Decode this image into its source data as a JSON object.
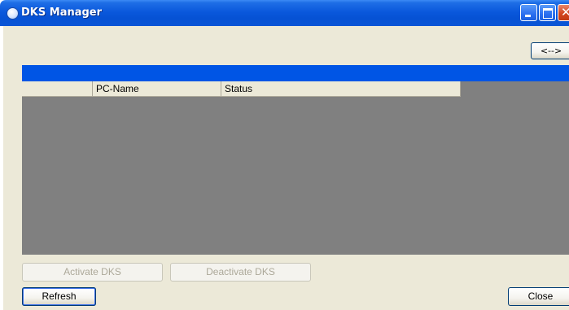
{
  "window": {
    "title": "DKS Manager",
    "close_glyph": "✕"
  },
  "toolbar": {
    "swap_label": "<-->"
  },
  "grid": {
    "columns": [
      "PC-Name",
      "Status"
    ],
    "rows": []
  },
  "actions": {
    "activate_label": "Activate DKS",
    "deactivate_label": "Deactivate DKS",
    "refresh_label": "Refresh",
    "close_label": "Close"
  },
  "colors": {
    "titlebar": "#0a58dc",
    "selection_bar": "#0055e5",
    "grid_background": "#808080",
    "dialog_background": "#ece9d8"
  }
}
